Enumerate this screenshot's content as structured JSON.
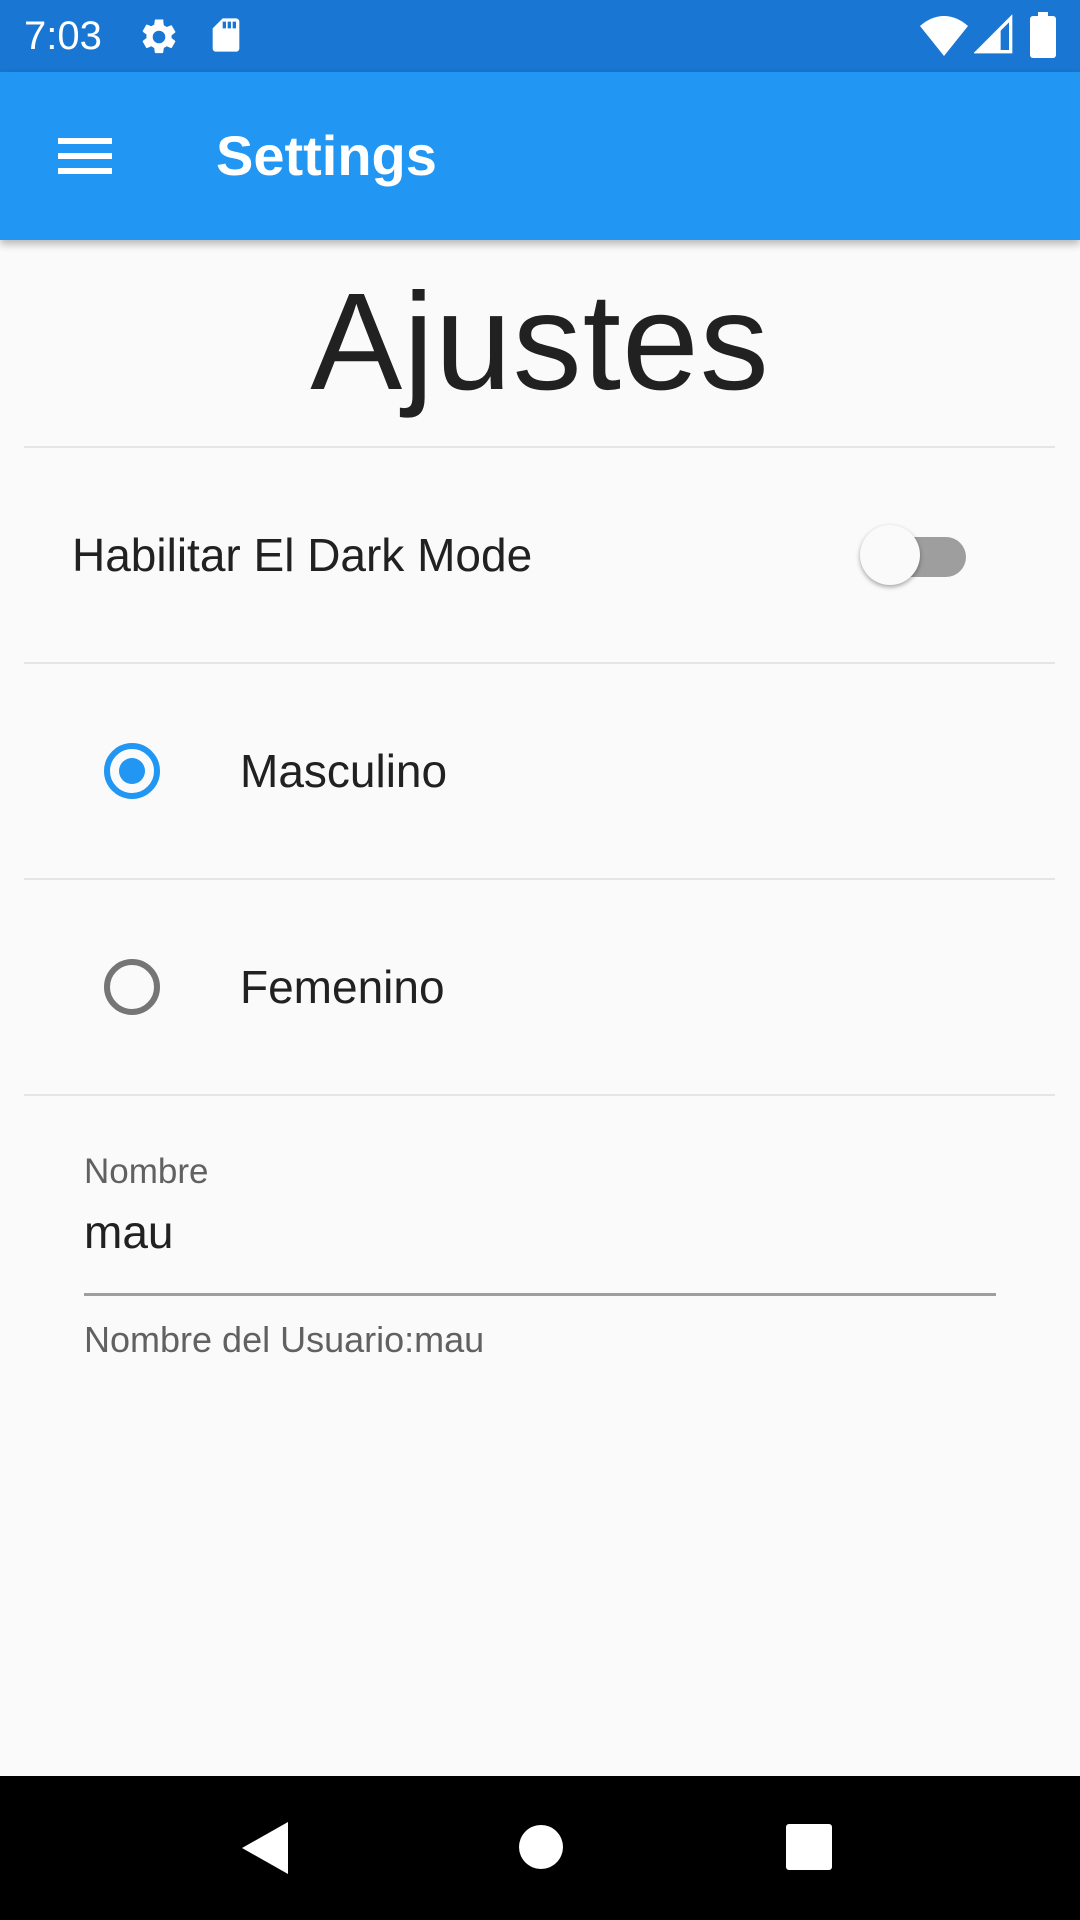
{
  "status_bar": {
    "time": "7:03",
    "icons": [
      "gear-icon",
      "sd-card-icon",
      "wifi-icon",
      "signal-icon",
      "battery-icon"
    ]
  },
  "app_bar": {
    "title": "Settings",
    "menu_icon": "hamburger-menu-icon",
    "color": "#2196f3"
  },
  "page": {
    "heading": "Ajustes"
  },
  "dark_mode": {
    "label": "Habilitar El Dark Mode",
    "enabled": false
  },
  "gender": {
    "options": [
      {
        "label": "Masculino",
        "selected": true
      },
      {
        "label": "Femenino",
        "selected": false
      }
    ],
    "accent": "#2196f3"
  },
  "name_field": {
    "label": "Nombre",
    "value": "mau",
    "helper": "Nombre del Usuario:mau"
  },
  "nav_bar": {
    "buttons": [
      "back-icon",
      "home-icon",
      "recents-icon"
    ]
  }
}
